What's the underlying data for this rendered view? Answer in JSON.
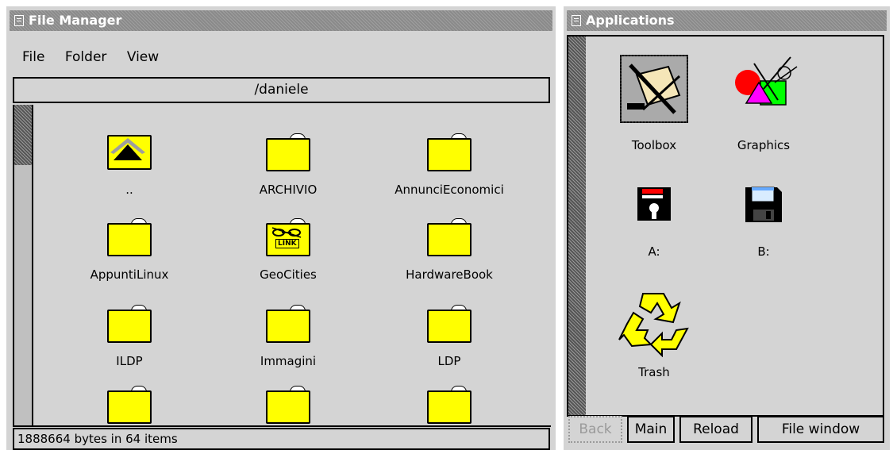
{
  "file_manager": {
    "title": "File Manager",
    "menu": [
      "File",
      "Folder",
      "View"
    ],
    "path": "/daniele",
    "items": [
      {
        "label": "..",
        "icon": "parent-folder-icon"
      },
      {
        "label": "ARCHIVIO",
        "icon": "folder-icon"
      },
      {
        "label": "AnnunciEconomici",
        "icon": "folder-icon"
      },
      {
        "label": "AppuntiLinux",
        "icon": "folder-icon"
      },
      {
        "label": "GeoCities",
        "icon": "link-folder-icon"
      },
      {
        "label": "HardwareBook",
        "icon": "folder-icon"
      },
      {
        "label": "ILDP",
        "icon": "folder-icon"
      },
      {
        "label": "Immagini",
        "icon": "folder-icon"
      },
      {
        "label": "LDP",
        "icon": "folder-icon"
      },
      {
        "label": "",
        "icon": "folder-icon"
      },
      {
        "label": "",
        "icon": "folder-icon"
      },
      {
        "label": "",
        "icon": "folder-icon"
      }
    ],
    "link_badge": "LINK",
    "status": "1888664 bytes in 64 items"
  },
  "applications": {
    "title": "Applications",
    "items": [
      {
        "label": "Toolbox",
        "icon": "toolbox-icon"
      },
      {
        "label": "Graphics",
        "icon": "graphics-icon"
      },
      {
        "label": "A:",
        "icon": "floppy-a-icon"
      },
      {
        "label": "B:",
        "icon": "floppy-b-icon"
      },
      {
        "label": "Trash",
        "icon": "recycle-icon"
      }
    ],
    "buttons": {
      "back": "Back",
      "main": "Main",
      "reload": "Reload",
      "file_window": "File window"
    }
  },
  "colors": {
    "folder": "#ffff00",
    "window_bg": "#d4d4d4",
    "titlebar": "#8a8a8a"
  }
}
